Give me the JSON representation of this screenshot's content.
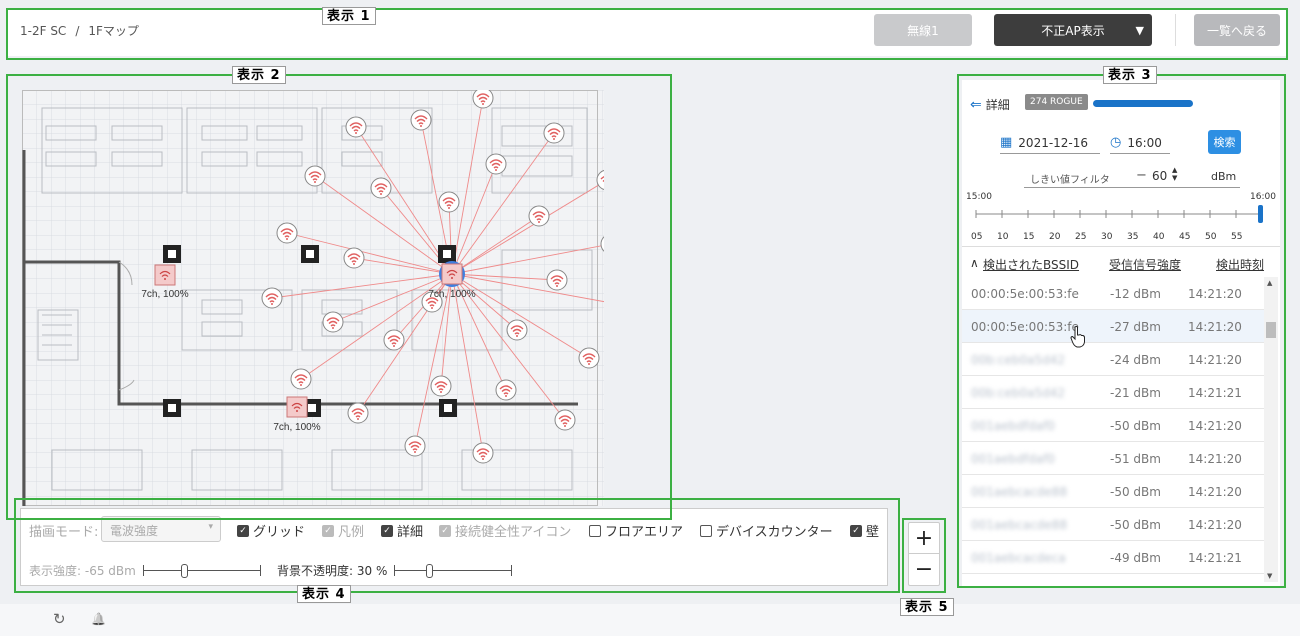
{
  "header": {
    "breadcrumb_site": "1-2F SC",
    "breadcrumb_sep": "/",
    "breadcrumb_floor": "1Fマップ",
    "wireless_label": "無線1",
    "rogue_label": "不正AP表示",
    "back_label": "一覧へ戻る"
  },
  "labels": {
    "area1": "表示 1",
    "area2": "表示 2",
    "area3": "表示 3",
    "area4": "表示 4",
    "area5": "表示 5"
  },
  "map": {
    "ap_labels": [
      "7ch, 100%",
      "7ch, 100%",
      "7ch, 100%"
    ]
  },
  "panel": {
    "detail_label": "詳細",
    "rogue_badge": "274 ROGUE",
    "progress": 1.0,
    "date": "2021-12-16",
    "time": "16:00",
    "search_label": "検索",
    "threshold_label": "しきい値フィルタ",
    "threshold_sign": "−",
    "threshold_value": "60",
    "threshold_unit": "dBm",
    "slider_start": "15:00",
    "slider_end": "16:00",
    "slider_ticks": [
      "05",
      "10",
      "15",
      "20",
      "25",
      "30",
      "35",
      "40",
      "45",
      "50",
      "55"
    ],
    "col_bssid": "検出されたBSSID",
    "col_signal": "受信信号強度",
    "col_time": "検出時刻",
    "rows": [
      {
        "bssid": "00:00:5e:00:53:fe",
        "signal": "-12 dBm",
        "time": "14:21:20"
      },
      {
        "bssid": "00:00:5e:00:53:fe",
        "signal": "-27 dBm",
        "time": "14:21:20"
      },
      {
        "bssid": "00b:ceb0a5d42",
        "signal": "-24 dBm",
        "time": "14:21:20"
      },
      {
        "bssid": "00b:ceb0a5d42",
        "signal": "-21 dBm",
        "time": "14:21:21"
      },
      {
        "bssid": "001aebdfdaf0",
        "signal": "-50 dBm",
        "time": "14:21:20"
      },
      {
        "bssid": "001aebdfdaf0",
        "signal": "-51 dBm",
        "time": "14:21:20"
      },
      {
        "bssid": "001aebcacde88",
        "signal": "-50 dBm",
        "time": "14:21:20"
      },
      {
        "bssid": "001aebcacde88",
        "signal": "-50 dBm",
        "time": "14:21:20"
      },
      {
        "bssid": "001aebcacdeca",
        "signal": "-49 dBm",
        "time": "14:21:21"
      }
    ]
  },
  "controls": {
    "mode_label": "描画モード:",
    "mode_value": "電波強度",
    "grid": "グリッド",
    "legend": "凡例",
    "details": "詳細",
    "health_icon": "接続健全性アイコン",
    "floor_area": "フロアエリア",
    "device_counter": "デバイスカウンター",
    "wall": "壁",
    "strength_label": "表示強度: -65 dBm",
    "opacity_label": "背景不透明度: 30 %"
  },
  "zoom": {
    "plus": "+",
    "minus": "−"
  },
  "footer": {
    "refresh_icon": "↻",
    "bell_icon": "🔔"
  }
}
